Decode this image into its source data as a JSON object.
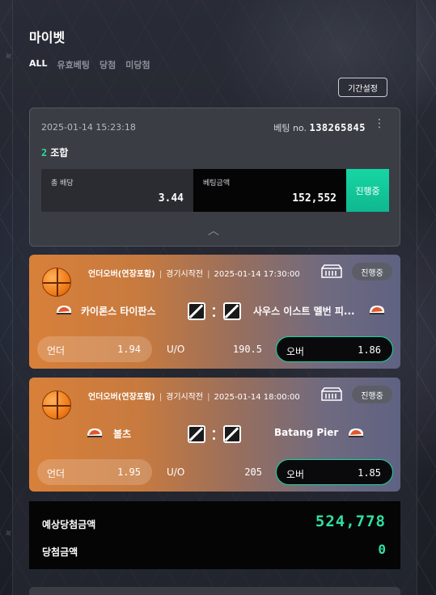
{
  "page": {
    "title": "마이벳"
  },
  "filters": [
    "ALL",
    "유효베팅",
    "당첨",
    "미당첨"
  ],
  "period_button": "기간설정",
  "summary": {
    "date": "2025-01-14 15:23:18",
    "bet_no_label": "베팅 no.",
    "bet_no": "138265845",
    "combo_count": "2",
    "combo_label": "조합",
    "odds_label": "총 배당",
    "odds_value": "3.44",
    "amount_label": "베팅금액",
    "amount_value": "152,552",
    "status": "진행중"
  },
  "games": [
    {
      "market": "언더오버(연장포함)",
      "start_label": "경기시작전",
      "datetime": "2025-01-14 17:30:00",
      "status": "진행중",
      "home": "카이론스 타이판스",
      "away": "사우스 이스트 멜번 피...",
      "under_label": "언더",
      "under_odds": "1.94",
      "uo_label": "U/O",
      "line": "190.5",
      "over_label": "오버",
      "over_odds": "1.86"
    },
    {
      "market": "언더오버(연장포함)",
      "start_label": "경기시작전",
      "datetime": "2025-01-14 18:00:00",
      "status": "진행중",
      "home": "볼츠",
      "away": "Batang Pier",
      "under_label": "언더",
      "under_odds": "1.95",
      "uo_label": "U/O",
      "line": "205",
      "over_label": "오버",
      "over_odds": "1.85"
    }
  ],
  "result": {
    "expected_label": "예상당첨금액",
    "expected_value": "524,778",
    "won_label": "당첨금액",
    "won_value": "0"
  },
  "colors": {
    "accent": "#18d59f",
    "orange": "#d8803a",
    "panel": "#3a3d44"
  }
}
